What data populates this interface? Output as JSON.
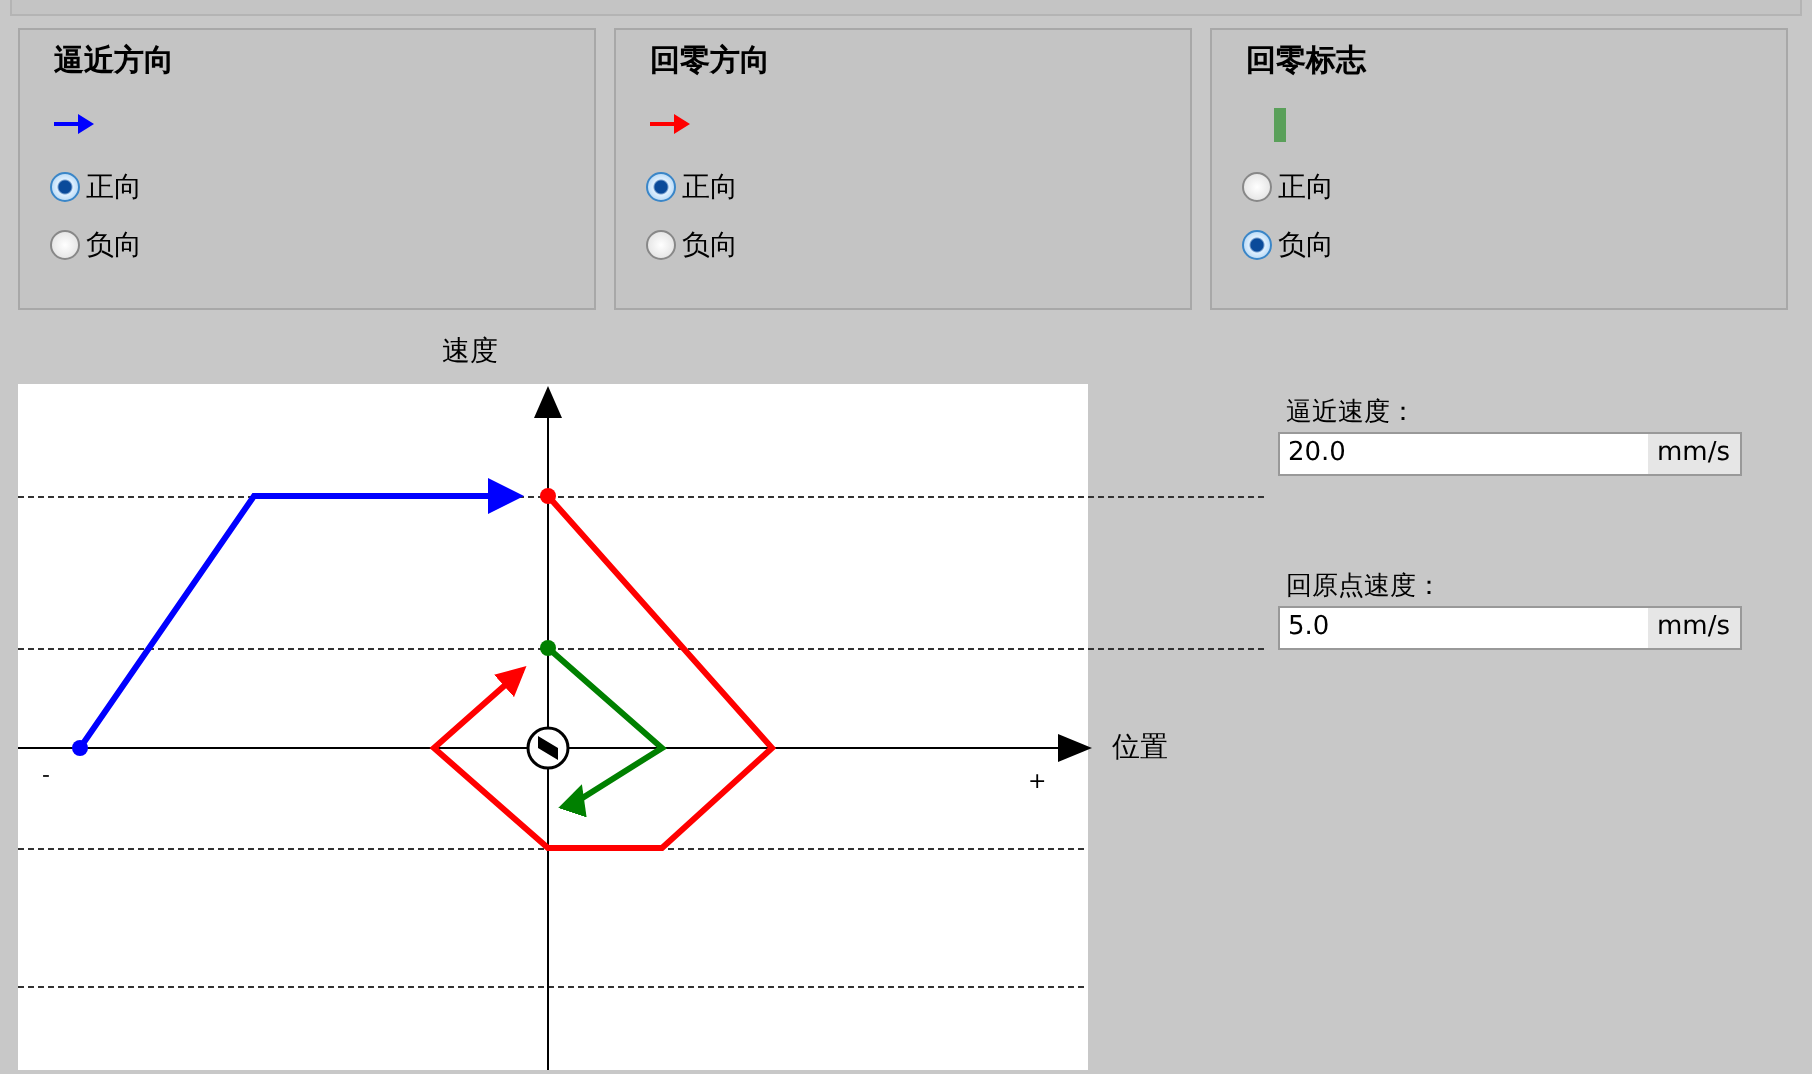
{
  "groups": [
    {
      "title": "逼近方向",
      "indicator": {
        "kind": "arrow",
        "color": "#0000ff"
      },
      "options": [
        {
          "label": "正向",
          "selected": true
        },
        {
          "label": "负向",
          "selected": false
        }
      ]
    },
    {
      "title": "回零方向",
      "indicator": {
        "kind": "arrow",
        "color": "#ff0000"
      },
      "options": [
        {
          "label": "正向",
          "selected": true
        },
        {
          "label": "负向",
          "selected": false
        }
      ]
    },
    {
      "title": "回零标志",
      "indicator": {
        "kind": "bar",
        "color": "#5aa05a"
      },
      "options": [
        {
          "label": "正向",
          "selected": false
        },
        {
          "label": "负向",
          "selected": true
        }
      ]
    }
  ],
  "diagram": {
    "y_axis_label": "速度",
    "x_axis_label": "位置",
    "minus_label": "-",
    "plus_label": "+"
  },
  "speeds": [
    {
      "label": "逼近速度：",
      "value": "20.0",
      "unit": "mm/s"
    },
    {
      "label": "回原点速度：",
      "value": "5.0",
      "unit": "mm/s"
    }
  ]
}
